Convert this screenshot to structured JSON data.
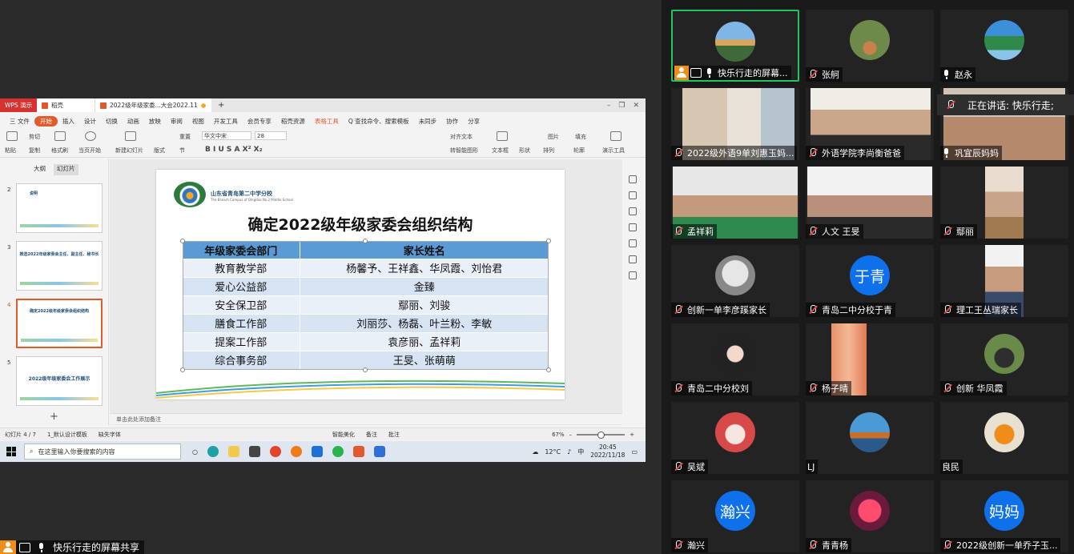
{
  "wps": {
    "tabs": [
      "WPS 演示",
      "稻壳",
      "2022级年级家委...大会2022.11"
    ],
    "menus": [
      "三 文件",
      "开始",
      "插入",
      "设计",
      "切换",
      "动画",
      "放映",
      "审阅",
      "视图",
      "开发工具",
      "会员专享",
      "稻壳资源",
      "表格工具",
      "Q 查找命令、搜索模板",
      "未同步",
      "协作",
      "分享"
    ],
    "ribbon": {
      "paste": "粘贴",
      "cut": "剪切",
      "copy": "复制",
      "format_painter": "格式刷",
      "from_current": "当页开始",
      "new_slide": "新建幻灯片",
      "layout": "版式",
      "section": "节",
      "reset": "重置",
      "font": "华文中宋",
      "size": "28",
      "align_text": "对齐文本",
      "convert_smartart": "转智能图形",
      "textbox": "文本框",
      "shape": "形状",
      "arrange": "排列",
      "outline": "轮廓",
      "picture": "图片",
      "fill": "填充",
      "presentation_tools": "演示工具"
    },
    "pane": {
      "outline_tab": "大纲",
      "slides_tab": "幻灯片"
    },
    "thumbs": [
      {
        "num": "2",
        "title": "说明"
      },
      {
        "num": "3",
        "title": "推选2022年级家委会主任、副主任、秘书长"
      },
      {
        "num": "4",
        "title": "确定2022级年级家委会组织结构"
      },
      {
        "num": "5",
        "title": "2022级年级家委会工作展示"
      }
    ],
    "slide": {
      "school_name": "山东省青岛第二中学分校",
      "school_sub": "The Branch Campus of Qingdao No.2 Middle School",
      "title": "确定2022级年级家委会组织结构",
      "headers": [
        "年级家委会部门",
        "家长姓名"
      ],
      "rows": [
        [
          "教育教学部",
          "杨馨予、王祥鑫、华凤霞、刘怡君"
        ],
        [
          "爱心公益部",
          "金臻"
        ],
        [
          "安全保卫部",
          "鄢丽、刘骏"
        ],
        [
          "膳食工作部",
          "刘丽莎、杨磊、叶兰粉、李敏"
        ],
        [
          "提案工作部",
          "袁彦丽、孟祥莉"
        ],
        [
          "综合事务部",
          "王旻、张萌萌"
        ]
      ]
    },
    "notes": "单击此处添加备注",
    "status": {
      "slide_count": "幻灯片 4 / 7",
      "theme": "1_默认设计模板",
      "missing_font": "缺失字体",
      "smart_beautify": "智能美化",
      "notes_btn": "备注",
      "comments_btn": "批注",
      "zoom": "67%"
    },
    "taskbar": {
      "search_placeholder": "在这里输入你要搜索的内容",
      "weather": "12°C",
      "ime": "中",
      "time": "20:45",
      "date": "2022/11/18"
    }
  },
  "share_label": "快乐行走的屏幕共享",
  "speaking_label": "正在讲话: 快乐行走;",
  "participants": [
    {
      "name": "快乐行走的屏幕...",
      "mic": "on"
    },
    {
      "name": "张舸",
      "mic": "muted"
    },
    {
      "name": "赵永",
      "mic": "on"
    },
    {
      "name": "2022级外语9单刘惠玉妈...",
      "mic": "muted"
    },
    {
      "name": "外语学院李尚衡爸爸",
      "mic": "muted"
    },
    {
      "name": "巩宜辰妈妈",
      "mic": "on"
    },
    {
      "name": "孟祥莉",
      "mic": "muted"
    },
    {
      "name": "人文  王旻",
      "mic": "muted"
    },
    {
      "name": "鄢丽",
      "mic": "muted"
    },
    {
      "name": "创新一单李彦蹊家长",
      "mic": "muted"
    },
    {
      "name": "青岛二中分校于青",
      "mic": "muted",
      "initials": "于青"
    },
    {
      "name": "理工王丛瑞家长",
      "mic": "muted"
    },
    {
      "name": "青岛二中分校刘",
      "mic": "muted"
    },
    {
      "name": "杨子晴",
      "mic": "muted"
    },
    {
      "name": "创新 华凤霞",
      "mic": "muted"
    },
    {
      "name": "吴斌",
      "mic": "muted"
    },
    {
      "name": "LJ",
      "mic": "none"
    },
    {
      "name": "良民",
      "mic": "none"
    },
    {
      "name": "瀚兴",
      "mic": "muted",
      "initials": "瀚兴"
    },
    {
      "name": "青青杨",
      "mic": "muted"
    },
    {
      "name": "2022级创新一单乔子玉...",
      "mic": "muted",
      "initials": "妈妈"
    }
  ]
}
